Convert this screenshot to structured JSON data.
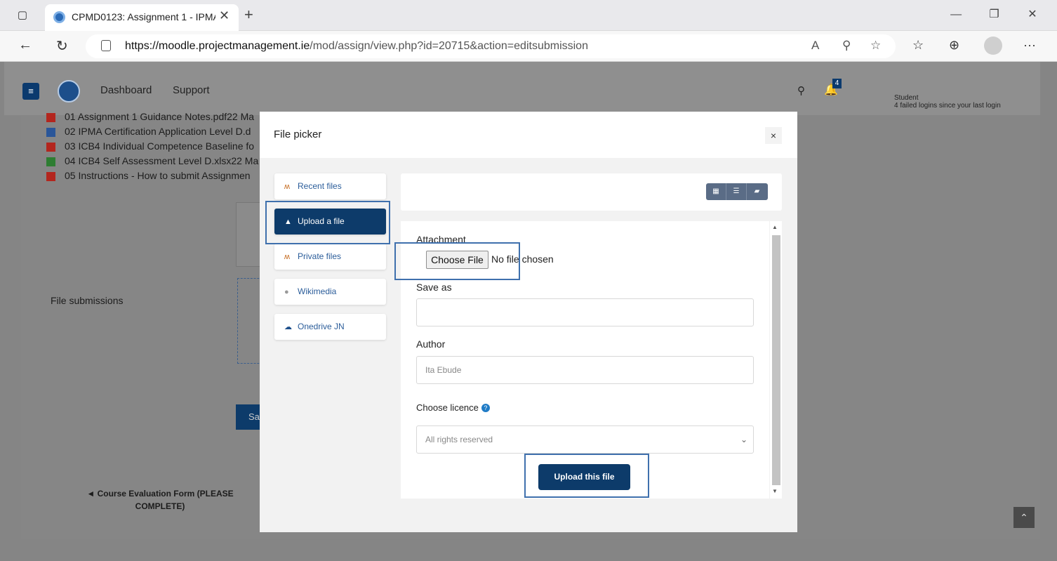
{
  "browser": {
    "tab_title": "CPMD0123: Assignment 1 - IPMA",
    "tab_close": "✕",
    "new_tab": "+",
    "url_host": "https://moodle.projectmanagement.ie",
    "url_path": "/mod/assign/view.php?id=20715&action=editsubmission",
    "more_label": "···"
  },
  "moodle_header": {
    "nav": [
      "Dashboard",
      "Support"
    ],
    "notification_count": "4",
    "user_role": "Student",
    "user_status": "4 failed logins since your last login"
  },
  "background_page": {
    "files": [
      {
        "name": "01 Assignment 1 Guidance Notes.pdf22 Ma",
        "type": "pdf"
      },
      {
        "name": "02 IPMA Certification Application Level D.d",
        "type": "word"
      },
      {
        "name": "03 ICB4 Individual Competence Baseline fo",
        "type": "pdf"
      },
      {
        "name": "04 ICB4 Self Assessment Level D.xlsx22 Ma",
        "type": "excel"
      },
      {
        "name": "05 Instructions - How to submit Assignmen",
        "type": "pdf"
      }
    ],
    "file_submissions_label": "File submissions",
    "save_partial": "Sa",
    "course_link_prefix": "◄",
    "course_link": "Course Evaluation Form (PLEASE COMPLETE)"
  },
  "file_picker": {
    "title": "File picker",
    "repositories": [
      {
        "label": "Recent files",
        "icon": "moodle-icon",
        "active": false
      },
      {
        "label": "Upload a file",
        "icon": "upload-icon",
        "active": true
      },
      {
        "label": "Private files",
        "icon": "moodle-icon",
        "active": false
      },
      {
        "label": "Wikimedia",
        "icon": "wikimedia-icon",
        "active": false
      },
      {
        "label": "Onedrive JN",
        "icon": "cloud-icon",
        "active": false
      }
    ],
    "form": {
      "attachment_label": "Attachment",
      "choose_file_label": "Choose File",
      "no_file_text": "No file chosen",
      "save_as_label": "Save as",
      "save_as_value": "",
      "author_label": "Author",
      "author_value": "Ita Ebude",
      "licence_label": "Choose licence",
      "licence_value": "All rights reserved",
      "upload_button": "Upload this file"
    }
  },
  "colors": {
    "primary": "#0d3b6a",
    "highlight": "#3f70ad",
    "link": "#2b5d9a"
  }
}
